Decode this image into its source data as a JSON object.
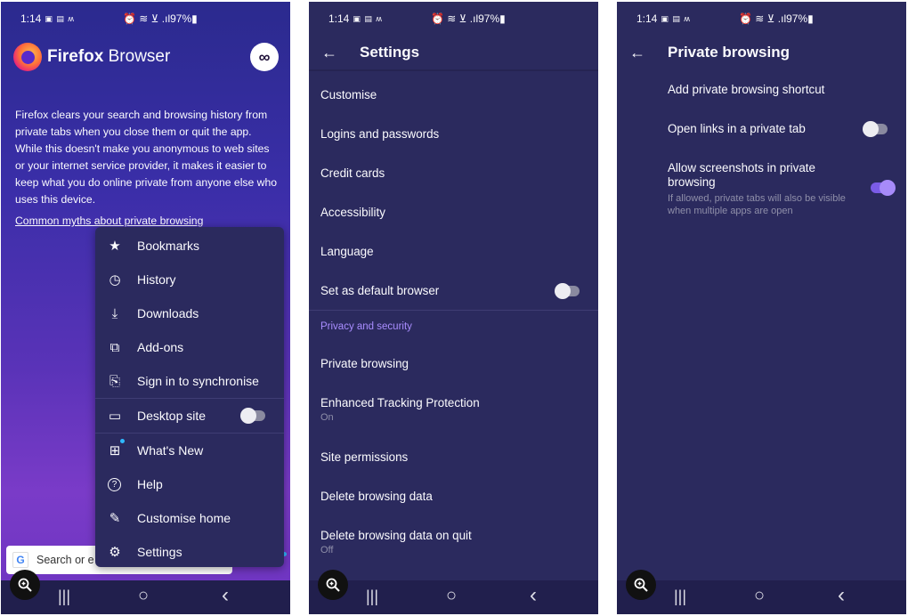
{
  "status": {
    "time": "1:14",
    "left_icons": "▣ ▤ ʍ",
    "right_icons": "⏰ ≋ ⊻ .ıl",
    "battery": "97%▮"
  },
  "phone1": {
    "brand_strong": "Firefox",
    "brand_rest": " Browser",
    "private_mode_icon": "∞",
    "intro_text": "Firefox clears your search and browsing history from private tabs when you close them or quit the app. While this doesn't make you anonymous to web sites or your internet service provider, it makes it easier to keep what you do online private from anyone else who uses this device.",
    "myths_link": "Common myths about private browsing",
    "menu": [
      {
        "label": "Bookmarks",
        "icon": "★"
      },
      {
        "label": "History",
        "icon": "◷"
      },
      {
        "label": "Downloads",
        "icon": "⤓"
      },
      {
        "label": "Add-ons",
        "icon": "⧉"
      },
      {
        "label": "Sign in to synchronise",
        "icon": "⎘"
      },
      {
        "label": "Desktop site",
        "icon": "▭"
      },
      {
        "label": "What's New",
        "icon": "⊞"
      },
      {
        "label": "Help",
        "icon": "?"
      },
      {
        "label": "Customise home",
        "icon": "✎"
      },
      {
        "label": "Settings",
        "icon": "⚙"
      }
    ],
    "search_placeholder": "Search or e",
    "search_logo": "G"
  },
  "phone2": {
    "title": "Settings",
    "items": [
      {
        "label": "Customise",
        "sub": ""
      },
      {
        "label": "Logins and passwords",
        "sub": ""
      },
      {
        "label": "Credit cards",
        "sub": ""
      },
      {
        "label": "Accessibility",
        "sub": ""
      },
      {
        "label": "Language",
        "sub": ""
      },
      {
        "label": "Set as default browser",
        "sub": ""
      }
    ],
    "section_header": "Privacy and security",
    "privacy_items": [
      {
        "label": "Private browsing",
        "sub": ""
      },
      {
        "label": "Enhanced Tracking Protection",
        "sub": "On"
      },
      {
        "label": "Site permissions",
        "sub": ""
      },
      {
        "label": "Delete browsing data",
        "sub": ""
      },
      {
        "label": "Delete browsing data on quit",
        "sub": "Off"
      }
    ]
  },
  "phone3": {
    "title": "Private browsing",
    "items": [
      {
        "label": "Add private browsing shortcut",
        "sub": ""
      },
      {
        "label": "Open links in a private tab",
        "sub": ""
      },
      {
        "label": "Allow screenshots in private browsing",
        "sub": "If allowed, private tabs will also be visible when multiple apps are open"
      }
    ]
  },
  "toggles": {
    "desktop_site": false,
    "default_browser": false,
    "open_links_private": false,
    "allow_screenshots": true
  },
  "navbar": {
    "recents": "|||",
    "home": "○",
    "back": "‹"
  }
}
